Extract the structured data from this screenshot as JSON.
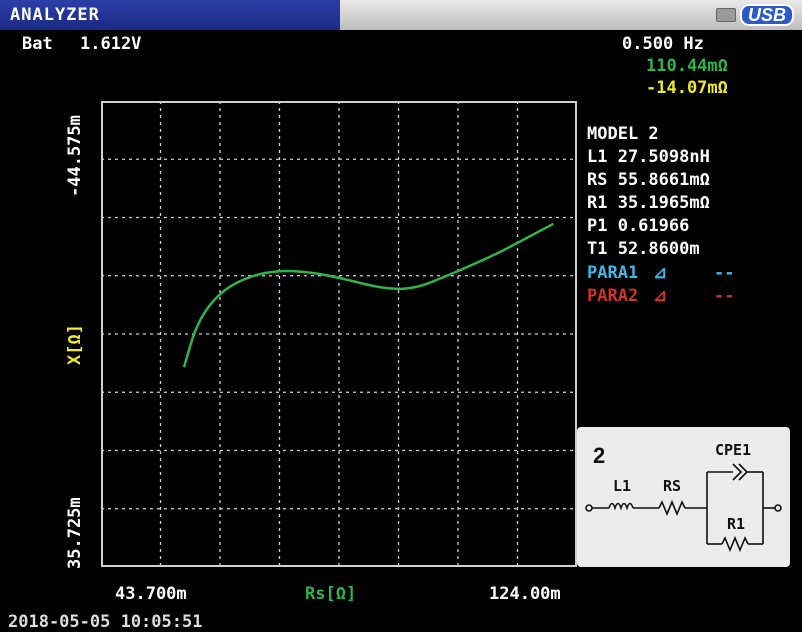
{
  "app": {
    "title": "ANALYZER",
    "usb_label": "USB"
  },
  "status": {
    "battery_label": "Bat",
    "battery_value": "1.612V",
    "frequency": "0.500 Hz",
    "value_green": "110.44mΩ",
    "value_yellow": "-14.07mΩ"
  },
  "model": {
    "lines": [
      "MODEL 2",
      "L1 27.5098nH",
      "RS 55.8661mΩ",
      "R1 35.1965mΩ",
      "P1 0.61966",
      "T1 52.8600m"
    ],
    "para1_label": "PARA1",
    "para1_value": "--",
    "para2_label": "PARA2",
    "para2_value": "--"
  },
  "colors": {
    "para1": "#3fb6e6",
    "para2": "#d0302e",
    "trace": "#2fb34a",
    "green_text": "#2fb34a",
    "yellow_text": "#f0e92a",
    "grid": "#cfcfcf",
    "axis_x_label": "#2fb34a",
    "axis_y_label": "#f0e92a"
  },
  "circuit": {
    "number": "2",
    "labels": [
      "L1",
      "RS",
      "CPE1",
      "R1"
    ]
  },
  "chart_data": {
    "type": "line",
    "xlabel": "Rs[Ω]",
    "ylabel": "X[Ω]",
    "x_tick_labels": [
      "43.700m",
      "124.00m"
    ],
    "y_tick_labels": [
      "-44.575m",
      "35.725m"
    ],
    "xlim": [
      0.0437,
      0.124
    ],
    "ylim": [
      -0.044575,
      0.035725
    ],
    "y_inverted": true,
    "grid": true,
    "series": [
      {
        "x": [
          0.0577,
          0.06,
          0.064,
          0.069,
          0.074,
          0.079,
          0.084,
          0.089,
          0.093,
          0.097,
          0.101,
          0.106,
          0.111,
          0.115,
          0.12
        ],
        "y": [
          0.0013,
          -0.0067,
          -0.0119,
          -0.0145,
          -0.0154,
          -0.0151,
          -0.0141,
          -0.0128,
          -0.0121,
          -0.0124,
          -0.014,
          -0.0162,
          -0.0185,
          -0.0207,
          -0.0234
        ]
      }
    ]
  },
  "footer": {
    "timestamp_partial": "2018-05-05 10:05:51"
  }
}
